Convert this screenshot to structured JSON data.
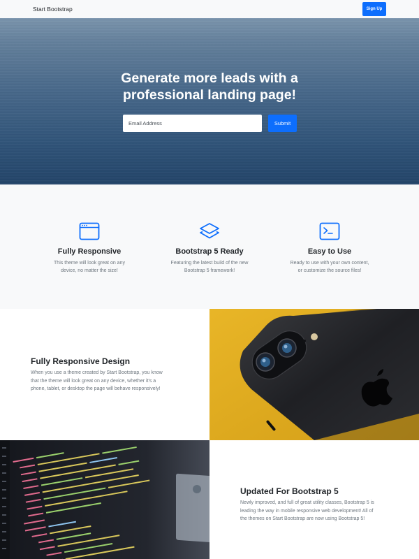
{
  "navbar": {
    "brand": "Start Bootstrap",
    "signup_label": "Sign Up"
  },
  "hero": {
    "title_line1": "Generate more leads with a",
    "title_line2": "professional landing page!",
    "email_placeholder": "Email Address",
    "submit_label": "Submit"
  },
  "features": [
    {
      "icon": "window-icon",
      "title": "Fully Responsive",
      "line1": "This theme will look great on any",
      "line2": "device, no matter the size!"
    },
    {
      "icon": "layers-icon",
      "title": "Bootstrap 5 Ready",
      "line1": "Featuring the latest build of the new",
      "line2": "Bootstrap 5 framework!"
    },
    {
      "icon": "terminal-icon",
      "title": "Easy to Use",
      "line1": "Ready to use with your own content,",
      "line2": "or customize the source files!"
    }
  ],
  "showcase": [
    {
      "title": "Fully Responsive Design",
      "line1": "When you use a theme created by Start Bootstrap, you know",
      "line2": "that the theme will look great on any device, whether it's a",
      "line3": "phone, tablet, or desktop the page will behave responsively!"
    },
    {
      "title": "Updated For Bootstrap 5",
      "line1": "Newly improved, and full of great utility classes, Bootstrap 5 is",
      "line2": "leading the way in mobile responsive web development! All of",
      "line3": "the themes on Start Bootstrap are now using Bootstrap 5!"
    }
  ],
  "colors": {
    "primary": "#0d6efd",
    "light_bg": "#f8f9fa",
    "muted_text": "#6c757d"
  }
}
